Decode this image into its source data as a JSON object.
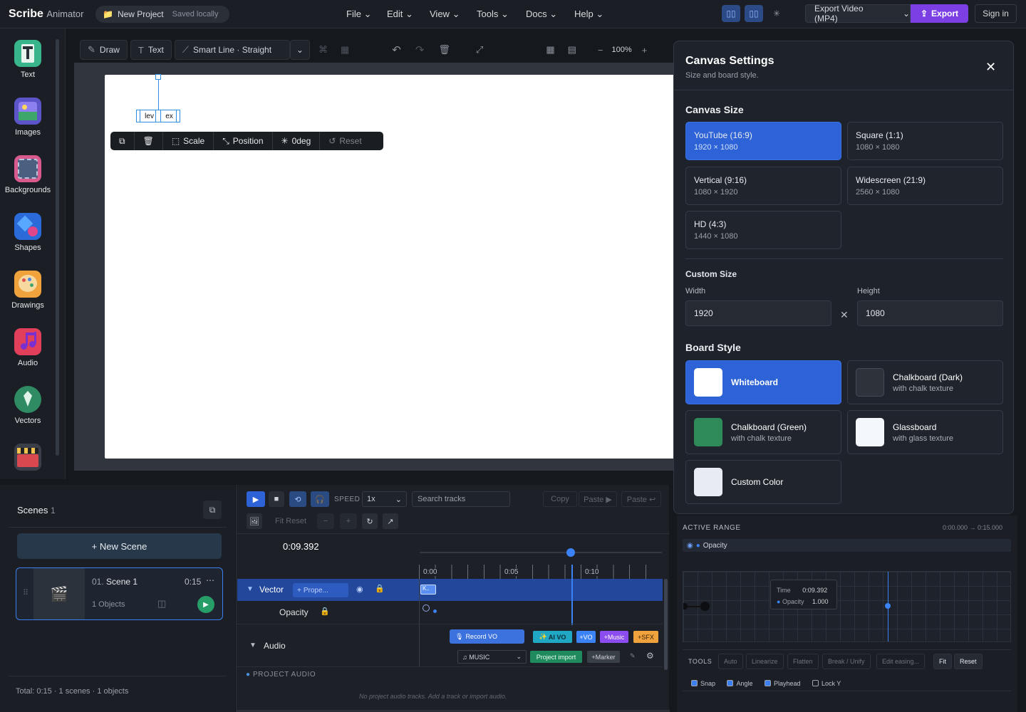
{
  "app": {
    "name": "Scribe",
    "name_suffix": "Animator",
    "project": "New Project",
    "save_status": "Saved locally"
  },
  "menu": [
    "File",
    "Edit",
    "View",
    "Tools",
    "Docs",
    "Help"
  ],
  "export": {
    "format": "Export Video (MP4)",
    "button": "Export",
    "signin": "Sign in"
  },
  "sidebar": [
    {
      "label": "Text"
    },
    {
      "label": "Images"
    },
    {
      "label": "Backgrounds"
    },
    {
      "label": "Shapes"
    },
    {
      "label": "Drawings"
    },
    {
      "label": "Audio"
    },
    {
      "label": "Vectors"
    }
  ],
  "canvas_toolbar": {
    "draw": "Draw",
    "text": "Text",
    "smart_line": "Smart Line · Straight",
    "zoom": "100%"
  },
  "selection": {
    "t1": "lev",
    "t2": "ex"
  },
  "float_toolbar": {
    "scale": "Scale",
    "position": "Position",
    "rotation": "0deg",
    "reset": "Reset"
  },
  "scenes": {
    "title": "Scenes",
    "count": "1",
    "new_label": "+ New Scene",
    "items": [
      {
        "num": "01.",
        "name": "Scene 1",
        "duration": "0:15",
        "objects": "1 Objects"
      }
    ],
    "total": "Total: 0:15 · 1 scenes · 1 objects"
  },
  "timeline": {
    "speed_label": "SPEED",
    "speed": "1x",
    "search_placeholder": "Search tracks",
    "copy": "Copy",
    "paste": "Paste ▶",
    "paste2": "Paste ↩",
    "fit_reset": "Fit Reset",
    "time": "0:09.392",
    "ticks": [
      "0:00",
      "0:05",
      "0:10"
    ],
    "tracks": {
      "vector": "Vector",
      "prop": "Prope...",
      "opacity": "Opacity",
      "audio": "Audio"
    },
    "audio_buttons": {
      "record": "Record VO",
      "ai": "AI VO",
      "vo": "+VO",
      "music": "+Music",
      "sfx": "+SFX",
      "music_select": "MUSIC",
      "import": "Project import",
      "marker": "+Marker"
    },
    "project_audio": "PROJECT AUDIO",
    "empty": "No project audio tracks. Add a track or import audio."
  },
  "canvas_settings": {
    "title": "Canvas Settings",
    "subtitle": "Size and board style.",
    "size_heading": "Canvas Size",
    "sizes": [
      {
        "name": "YouTube (16:9)",
        "dim": "1920 × 1080"
      },
      {
        "name": "Square (1:1)",
        "dim": "1080 × 1080"
      },
      {
        "name": "Vertical (9:16)",
        "dim": "1080 × 1920"
      },
      {
        "name": "Widescreen (21:9)",
        "dim": "2560 × 1080"
      },
      {
        "name": "HD (4:3)",
        "dim": "1440 × 1080"
      }
    ],
    "custom_heading": "Custom Size",
    "width_label": "Width",
    "height_label": "Height",
    "width": "1920",
    "height": "1080",
    "board_heading": "Board Style",
    "boards": [
      {
        "name": "Whiteboard",
        "sub": "",
        "color": "#ffffff"
      },
      {
        "name": "Chalkboard (Dark)",
        "sub": "with chalk texture",
        "color": "#2e333b"
      },
      {
        "name": "Chalkboard (Green)",
        "sub": "with chalk texture",
        "color": "#2f8a5a"
      },
      {
        "name": "Glassboard",
        "sub": "with glass texture",
        "color": "#f4f7fb"
      },
      {
        "name": "Custom Color",
        "sub": "",
        "color": "#e8ecf2"
      }
    ]
  },
  "keyframes": {
    "active_range": "ACTIVE RANGE",
    "range": "0:00.000 → 0:15.000",
    "track": "Opacity",
    "tooltip_time_label": "Time",
    "tooltip_time": "0:09.392",
    "tooltip_opacity_label": "Opacity",
    "tooltip_opacity": "1.000",
    "tools_label": "TOOLS",
    "tools": [
      "Auto",
      "Linearize",
      "Flatten",
      "Break / Unify",
      "Edit easing..."
    ],
    "fit": "Fit",
    "reset": "Reset",
    "checks": [
      {
        "label": "Snap",
        "on": true
      },
      {
        "label": "Angle",
        "on": true
      },
      {
        "label": "Playhead",
        "on": true
      },
      {
        "label": "Lock Y",
        "on": false
      }
    ]
  }
}
